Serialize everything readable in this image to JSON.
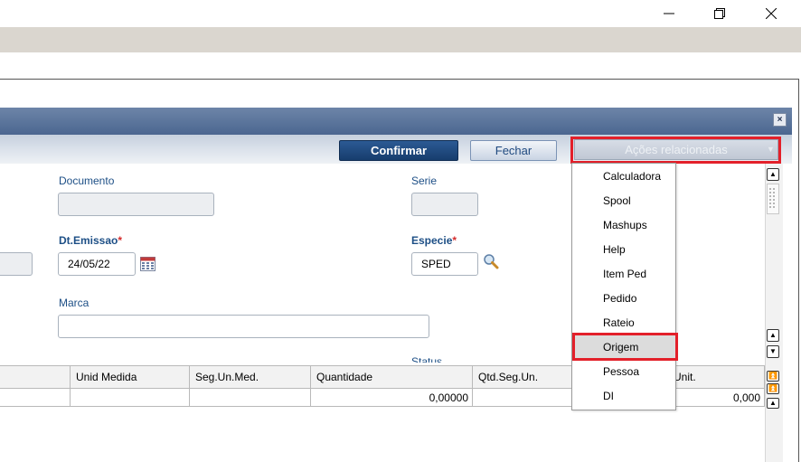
{
  "window": {
    "minimize": "–",
    "maximize": "❐",
    "close": "✕"
  },
  "dialog": {
    "close_label": "×"
  },
  "toolbar": {
    "confirm_label": "Confirmar",
    "close_label": "Fechar",
    "related_actions_label": "Ações relacionadas"
  },
  "form": {
    "documento_label": "Documento",
    "documento_value": "",
    "serie_label": "Serie",
    "serie_value": "",
    "dt_emissao_label": "Dt.Emissao",
    "dt_emissao_value": "24/05/22",
    "especie_label": "Especie",
    "especie_value": "SPED",
    "marca_label": "Marca",
    "marca_value": "",
    "required_marker": "*",
    "status_label": "Status"
  },
  "grid": {
    "columns": [
      "Unid Medida",
      "Seg.Un.Med.",
      "Quantidade",
      "Qtd.Seg.Un.",
      "Unit."
    ],
    "rows": [
      {
        "unid_medida": "",
        "seg_un_med": "",
        "quantidade": "0,00000",
        "qtd_seg_un": "",
        "unit": "0,000"
      }
    ]
  },
  "menu": {
    "items": [
      "Calculadora",
      "Spool",
      "Mashups",
      "Help",
      "Item Ped",
      "Pedido",
      "Rateio",
      "Origem",
      "Pessoa",
      "DI"
    ],
    "selected": "Origem"
  },
  "colors": {
    "highlight": "#e3202a",
    "primary_button": "#1f4a80",
    "label": "#1d4f86",
    "required": "#d52b2b"
  }
}
